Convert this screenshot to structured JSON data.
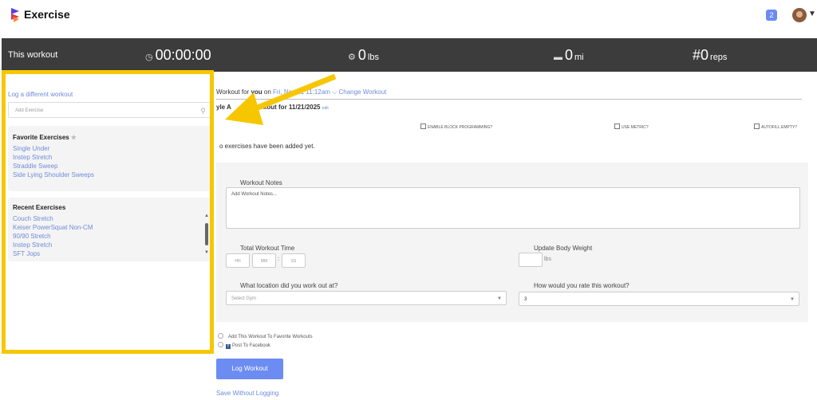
{
  "header": {
    "app_title": "Exercise",
    "notification_count": "2"
  },
  "stats": {
    "label": "This workout",
    "time": "00:00:00",
    "weight_value": "0",
    "weight_unit": "lbs",
    "distance_value": "0",
    "distance_unit": "mi",
    "reps_prefix": "#",
    "reps_value": "0",
    "reps_unit": "reps"
  },
  "left_panel": {
    "log_different_link": "Log a different workout",
    "add_exercise_placeholder": "Add Exercise",
    "favorites": {
      "title": "Favorite Exercises",
      "items": [
        "Single Under",
        "Instep Stretch",
        "Straddle Sweep",
        "Side Lying Shoulder Sweeps"
      ]
    },
    "recent": {
      "title": "Recent Exercises",
      "items": [
        "Couch Stretch",
        "Keiser PowerSquat Non-CM",
        "90/90 Stretch",
        "Instep Stretch",
        "SFT Jops"
      ]
    }
  },
  "main": {
    "workout_for_prefix": "Workout for",
    "workout_for_user": "you",
    "on_text": "on",
    "date_link": "Fri, Nov 21 11:12am",
    "change_workout": "Change Workout",
    "workout_title": "yle A",
    "workout_title_2": "s Workout for 11/21/2025",
    "edit_link": "edit",
    "checkboxes": [
      "ENABLE BLOCK PROGRAMMING?",
      "USE METRIC?",
      "AUTOFILL EMPTY?"
    ],
    "no_exercises": "o exercises have been added yet.",
    "notes_label": "Workout Notes",
    "notes_placeholder": "Add Workout Notes...",
    "total_time_label": "Total Workout Time",
    "hh": "HH",
    "mm": "MM",
    "ss": "SS",
    "colon": ":",
    "body_weight_label": "Update Body Weight",
    "body_weight_unit": "lbs",
    "location_label": "What location did you work out at?",
    "gym_placeholder": "Select Gym",
    "rating_label": "How would you rate this workout?",
    "rating_value": "3",
    "favorite_option": "Add This Workout To Favorite Workouts",
    "facebook_option": "Post To Facebook",
    "log_button": "Log Workout",
    "save_without_logging": "Save Without Logging"
  },
  "colors": {
    "accent": "#6c8cf2",
    "link": "#6f8cd9",
    "stats_bar": "#3c3c3c",
    "highlight": "#f6c700"
  }
}
